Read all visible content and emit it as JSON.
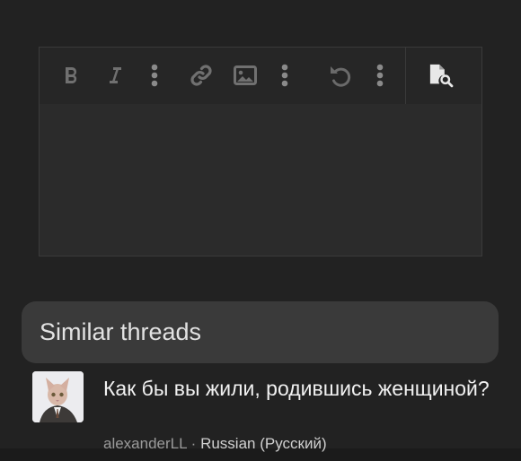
{
  "toolbar": {
    "buttons": [
      {
        "id": "bold",
        "icon": "bold-icon"
      },
      {
        "id": "italic",
        "icon": "italic-icon"
      },
      {
        "id": "more-text",
        "icon": "vertical-dots-icon"
      },
      {
        "id": "link",
        "icon": "link-icon"
      },
      {
        "id": "image",
        "icon": "image-icon"
      },
      {
        "id": "more-insert",
        "icon": "vertical-dots-icon"
      },
      {
        "id": "undo",
        "icon": "undo-icon"
      },
      {
        "id": "more-options",
        "icon": "vertical-dots-icon"
      },
      {
        "id": "preview",
        "icon": "preview-document-icon"
      }
    ]
  },
  "editor": {
    "content": ""
  },
  "similar": {
    "heading": "Similar threads",
    "threads": [
      {
        "title": "Как бы вы жили, родившись женщиной?",
        "author": "alexanderLL",
        "separator": " · ",
        "forum": "Russian (Русский)",
        "avatar_icon": "cat-avatar"
      }
    ]
  },
  "colors": {
    "background": "#222222",
    "editor": "#2b2b2b",
    "header_pill": "#3a3a3a",
    "icon": "#6f6f6f"
  }
}
